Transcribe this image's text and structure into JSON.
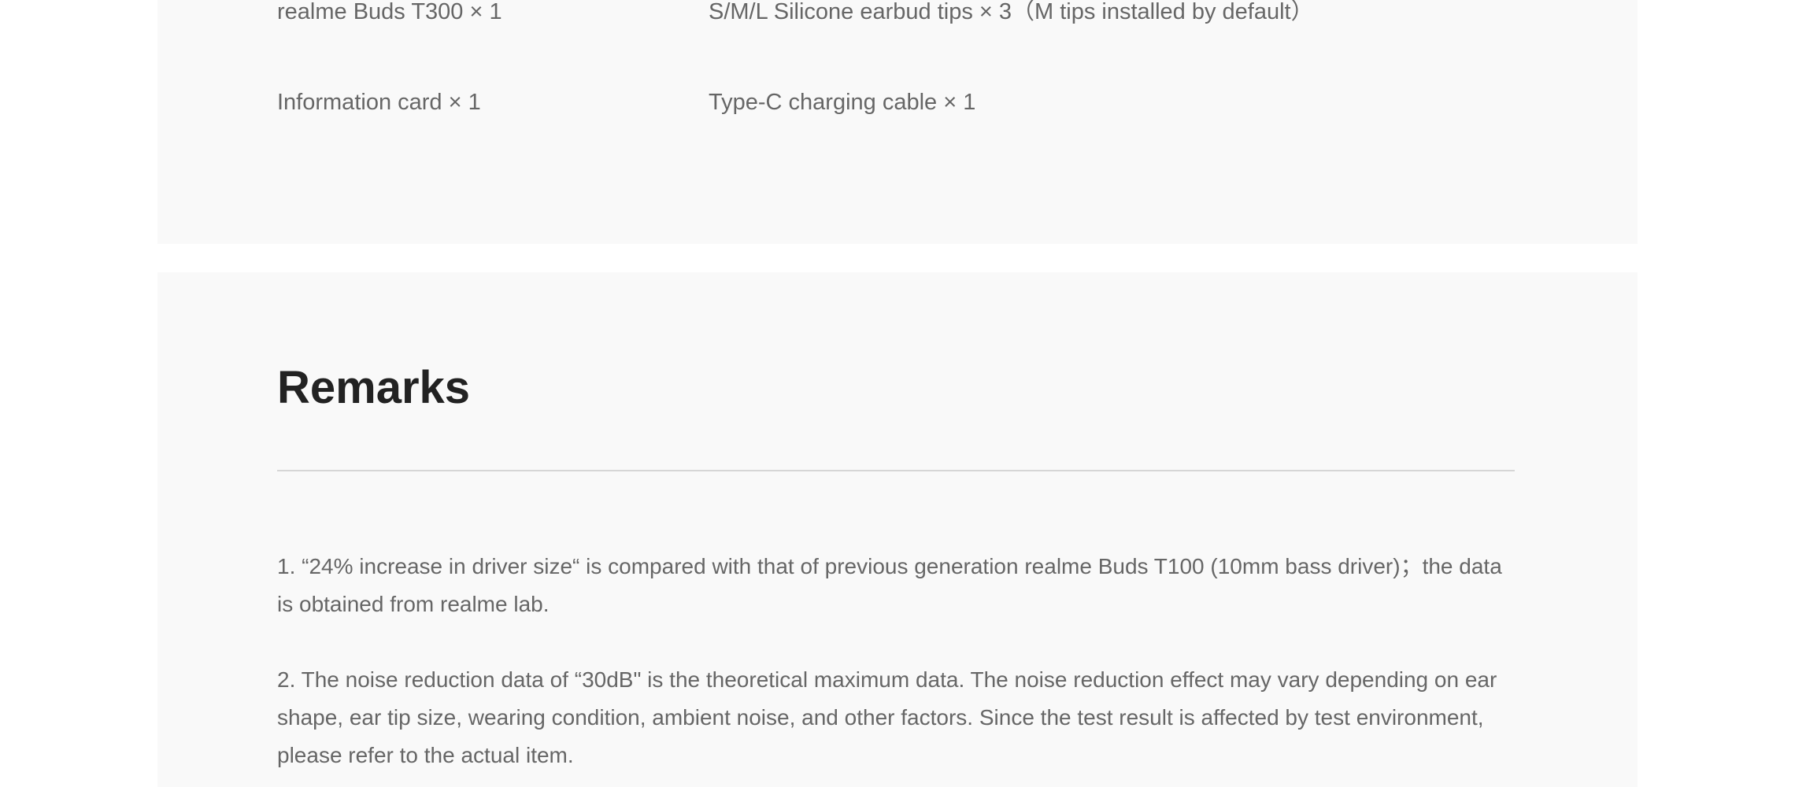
{
  "package_contents": {
    "items": [
      "realme Buds T300 × 1",
      "S/M/L Silicone earbud tips × 3（M tips installed by default）",
      "Information card × 1",
      "Type-C charging cable × 1"
    ]
  },
  "remarks": {
    "title": "Remarks",
    "items": [
      "1. “24% increase in driver size“ is compared with that of previous generation realme Buds T100 (10mm bass driver)；the data is obtained from realme lab.",
      "2. The noise reduction data of “30dB\" is the theoretical maximum data. The noise reduction effect may vary depending on ear shape, ear tip size, wearing condition, ambient noise, and other factors. Since the test result is affected by test environment, please refer to the actual item."
    ]
  }
}
